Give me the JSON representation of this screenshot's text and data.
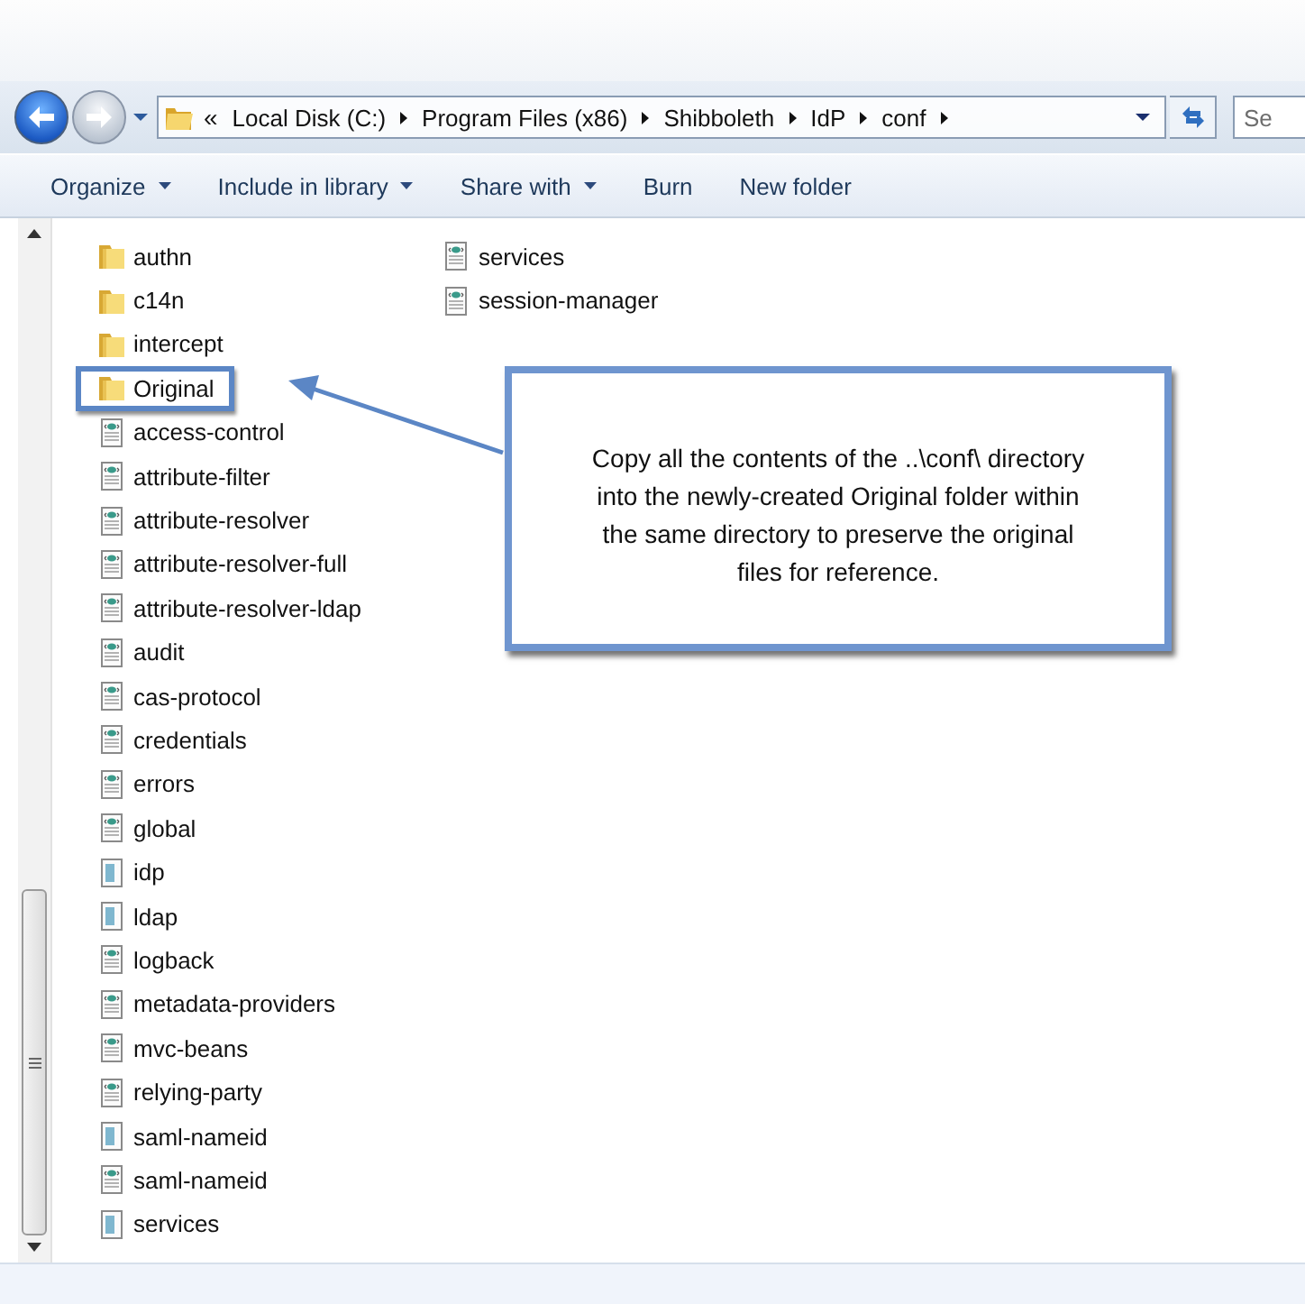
{
  "navigation": {
    "back_enabled": true,
    "forward_enabled": false
  },
  "address_bar": {
    "overflow": "«",
    "crumbs": [
      "Local Disk (C:)",
      "Program Files (x86)",
      "Shibboleth",
      "IdP",
      "conf"
    ]
  },
  "search": {
    "placeholder": "Se"
  },
  "toolbar": [
    {
      "label": "Organize",
      "dropdown": true
    },
    {
      "label": "Include in library",
      "dropdown": true
    },
    {
      "label": "Share with",
      "dropdown": true
    },
    {
      "label": "Burn",
      "dropdown": false
    },
    {
      "label": "New folder",
      "dropdown": false
    }
  ],
  "file_columns": [
    [
      {
        "name": "authn",
        "kind": "folder",
        "framed": false
      },
      {
        "name": "c14n",
        "kind": "folder",
        "framed": false
      },
      {
        "name": "intercept",
        "kind": "folder",
        "framed": false
      },
      {
        "name": "Original",
        "kind": "folder",
        "framed": true
      },
      {
        "name": "access-control",
        "kind": "config",
        "framed": false
      },
      {
        "name": "attribute-filter",
        "kind": "config",
        "framed": false
      },
      {
        "name": "attribute-resolver",
        "kind": "config",
        "framed": false
      },
      {
        "name": "attribute-resolver-full",
        "kind": "config",
        "framed": false
      },
      {
        "name": "attribute-resolver-ldap",
        "kind": "config",
        "framed": false
      },
      {
        "name": "audit",
        "kind": "config",
        "framed": false
      },
      {
        "name": "cas-protocol",
        "kind": "config",
        "framed": false
      },
      {
        "name": "credentials",
        "kind": "config",
        "framed": false
      },
      {
        "name": "errors",
        "kind": "config",
        "framed": false
      },
      {
        "name": "global",
        "kind": "config",
        "framed": false
      },
      {
        "name": "idp",
        "kind": "file",
        "framed": false
      },
      {
        "name": "ldap",
        "kind": "file",
        "framed": false
      },
      {
        "name": "logback",
        "kind": "config",
        "framed": false
      },
      {
        "name": "metadata-providers",
        "kind": "config",
        "framed": false
      },
      {
        "name": "mvc-beans",
        "kind": "config",
        "framed": false
      },
      {
        "name": "relying-party",
        "kind": "config",
        "framed": false
      },
      {
        "name": "saml-nameid",
        "kind": "file",
        "framed": false
      },
      {
        "name": "saml-nameid",
        "kind": "config",
        "framed": false
      },
      {
        "name": "services",
        "kind": "file",
        "framed": false
      }
    ],
    [
      {
        "name": "services",
        "kind": "config",
        "framed": false
      },
      {
        "name": "session-manager",
        "kind": "config",
        "framed": false
      }
    ]
  ],
  "callout": {
    "text": "Copy all the contents of the ..\\conf\\ directory into the newly-created Original folder within the same directory to preserve the original files for reference."
  }
}
